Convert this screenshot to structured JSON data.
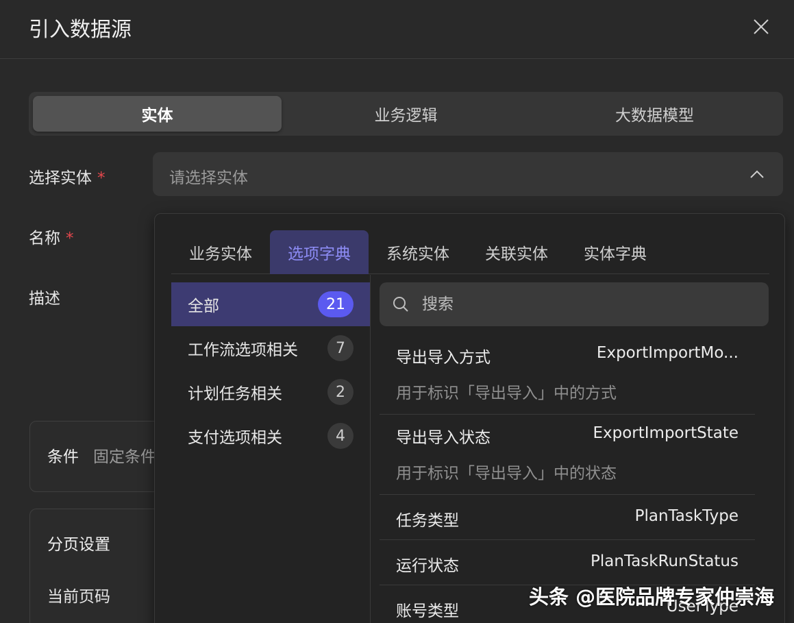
{
  "dialog": {
    "title": "引入数据源"
  },
  "source_tabs": [
    "实体",
    "业务逻辑",
    "大数据模型"
  ],
  "form": {
    "entity_label": "选择实体",
    "required_mark": "*",
    "entity_placeholder": "请选择实体",
    "name_label": "名称",
    "desc_label": "描述"
  },
  "conditions": {
    "title": "条件",
    "subtitle": "固定条件"
  },
  "pagination": {
    "title": "分页设置",
    "current_page_label": "当前页码"
  },
  "dropdown": {
    "tabs": [
      "业务实体",
      "选项字典",
      "系统实体",
      "关联实体",
      "实体字典"
    ],
    "active_tab": "选项字典",
    "categories": [
      {
        "label": "全部",
        "count": "21"
      },
      {
        "label": "工作流选项相关",
        "count": "7"
      },
      {
        "label": "计划任务相关",
        "count": "2"
      },
      {
        "label": "支付选项相关",
        "count": "4"
      }
    ],
    "search_placeholder": "搜索",
    "items": [
      {
        "name": "导出导入方式",
        "code": "ExportImportMo...",
        "desc": "用于标识「导出导入」中的方式"
      },
      {
        "name": "导出导入状态",
        "code": "ExportImportState",
        "desc": "用于标识「导出导入」中的状态"
      },
      {
        "name": "任务类型",
        "code": "PlanTaskType"
      },
      {
        "name": "运行状态",
        "code": "PlanTaskRunStatus"
      },
      {
        "name": "账号类型",
        "code": "UserType"
      }
    ]
  },
  "watermark": "头条 @医院品牌专家仲崇海",
  "colors": {
    "accent": "#5b5af0",
    "accent_text": "#8d8cf5",
    "required": "#e5484d",
    "background": "#292929"
  }
}
